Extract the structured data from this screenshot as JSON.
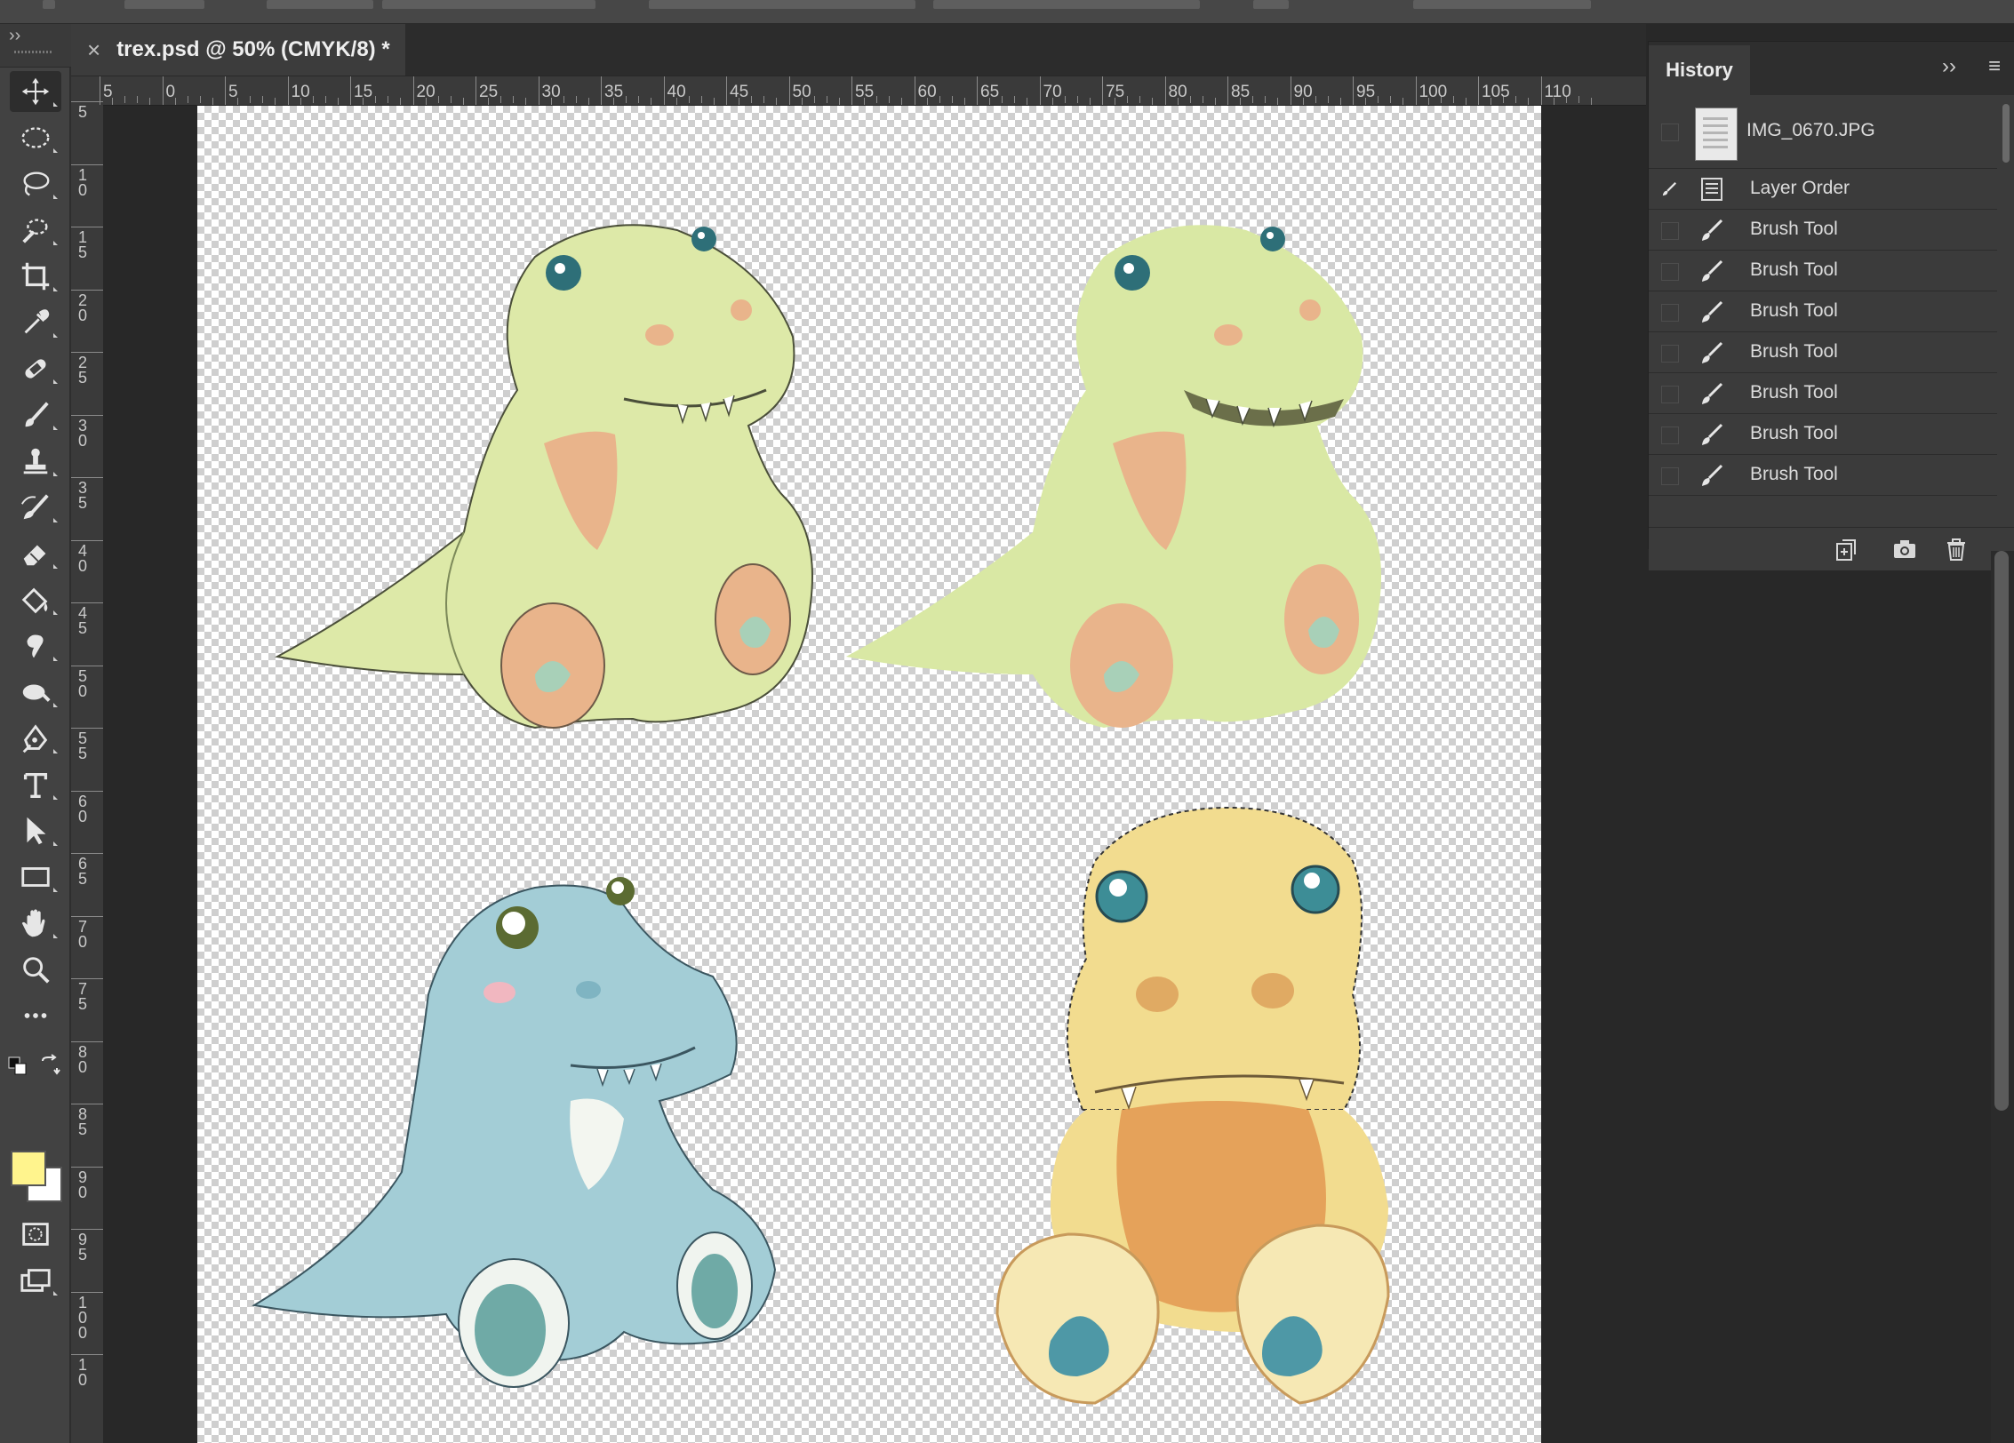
{
  "document": {
    "tab_title": "trex.psd @ 50% (CMYK/8) *",
    "close_glyph": "×"
  },
  "ruler": {
    "horizontal_labels": [
      "5",
      "0",
      "5",
      "10",
      "15",
      "20",
      "25",
      "30",
      "35",
      "40",
      "45",
      "50",
      "55",
      "60",
      "65",
      "70",
      "75",
      "80",
      "85",
      "90",
      "95",
      "100",
      "105",
      "110"
    ],
    "vertical_labels": [
      "5",
      "1\n0",
      "1\n5",
      "2\n0",
      "2\n5",
      "3\n0",
      "3\n5",
      "4\n0",
      "4\n5",
      "5\n0",
      "5\n5",
      "6\n0",
      "6\n5",
      "7\n0",
      "7\n5",
      "8\n0",
      "8\n5",
      "9\n0",
      "9\n5",
      "1\n0\n0",
      "1\n0"
    ]
  },
  "toolbar": {
    "collapse_glyph": "››",
    "tools": [
      {
        "name": "move-tool",
        "icon": "move-icon",
        "active": true
      },
      {
        "name": "marquee-tool",
        "icon": "elliptical-marquee-icon"
      },
      {
        "name": "lasso-tool",
        "icon": "lasso-icon"
      },
      {
        "name": "quick-selection-tool",
        "icon": "quick-selection-icon"
      },
      {
        "name": "crop-tool",
        "icon": "crop-icon"
      },
      {
        "name": "eyedropper-tool",
        "icon": "eyedropper-icon"
      },
      {
        "name": "healing-brush-tool",
        "icon": "bandage-icon"
      },
      {
        "name": "brush-tool",
        "icon": "brush-icon"
      },
      {
        "name": "clone-stamp-tool",
        "icon": "stamp-icon"
      },
      {
        "name": "history-brush-tool",
        "icon": "history-brush-icon"
      },
      {
        "name": "eraser-tool",
        "icon": "eraser-icon"
      },
      {
        "name": "paint-bucket-tool",
        "icon": "paint-bucket-icon"
      },
      {
        "name": "smudge-tool",
        "icon": "smudge-icon"
      },
      {
        "name": "dodge-tool",
        "icon": "dodge-icon"
      },
      {
        "name": "pen-tool",
        "icon": "pen-icon"
      },
      {
        "name": "type-tool",
        "icon": "type-icon"
      },
      {
        "name": "path-selection-tool",
        "icon": "arrow-select-icon"
      },
      {
        "name": "rectangle-tool",
        "icon": "rectangle-icon"
      },
      {
        "name": "hand-tool",
        "icon": "hand-icon"
      },
      {
        "name": "zoom-tool",
        "icon": "zoom-icon"
      },
      {
        "name": "more-tools",
        "icon": "ellipsis-icon"
      }
    ],
    "foreground_color": "#fff48d",
    "background_color": "#ffffff"
  },
  "history": {
    "panel_title": "History",
    "snapshot": {
      "label": "IMG_0670.JPG"
    },
    "states": [
      {
        "label": "Layer Order",
        "icon": "layer-order-icon"
      },
      {
        "label": "Brush Tool",
        "icon": "brush-icon"
      },
      {
        "label": "Brush Tool",
        "icon": "brush-icon"
      },
      {
        "label": "Brush Tool",
        "icon": "brush-icon"
      },
      {
        "label": "Brush Tool",
        "icon": "brush-icon"
      },
      {
        "label": "Brush Tool",
        "icon": "brush-icon"
      },
      {
        "label": "Brush Tool",
        "icon": "brush-icon"
      },
      {
        "label": "Brush Tool",
        "icon": "brush-icon"
      }
    ],
    "footer_buttons": [
      "new-document-from-state-icon",
      "camera-icon",
      "trash-icon"
    ]
  },
  "colors": {
    "panel_bg": "#3b3b3b",
    "app_bg": "#282828",
    "dino_green": "#d9e8a4",
    "dino_blue": "#a3cdd6",
    "dino_yellow": "#f2dc8f",
    "belly_peach": "#e9b48b",
    "belly_orange": "#e5a25a",
    "eye_teal": "#2e6f78"
  }
}
